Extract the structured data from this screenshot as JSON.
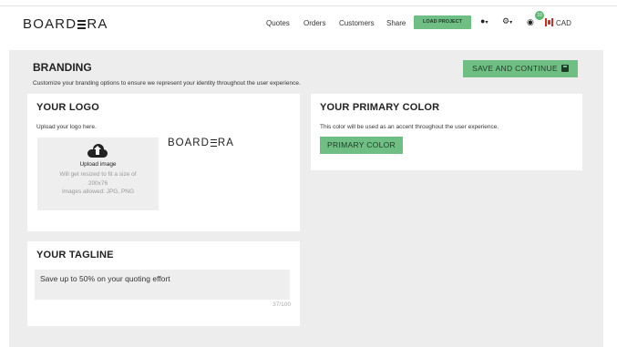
{
  "header": {
    "logo_text_left": "BOARD",
    "logo_text_right": "RA",
    "nav": [
      "Quotes",
      "Orders",
      "Customers",
      "Share"
    ],
    "load_project_label": "LOAD PROJECT",
    "user_icon": "user-icon",
    "settings_icon": "gear-icon",
    "notifications_icon": "chat-icon",
    "notifications_count": "10",
    "currency": "CAD"
  },
  "page": {
    "title": "BRANDING",
    "subtitle": "Customize your branding options to ensure we represent your identity throughout the user experience.",
    "save_label": "SAVE AND CONTINUE"
  },
  "logo_card": {
    "title": "YOUR LOGO",
    "description": "Upload your logo here.",
    "upload_label": "Upload image",
    "upload_help_1": "Will get resized to fit a size of 200x76",
    "upload_help_2": "Images allowed: JPG, PNG",
    "preview_left": "BOARD",
    "preview_right": "RA"
  },
  "color_card": {
    "title": "YOUR PRIMARY COLOR",
    "description": "This color will be used as an accent throughout the user experience.",
    "button_label": "PRIMARY COLOR"
  },
  "tagline_card": {
    "title": "YOUR TAGLINE",
    "value": "Save up to 50% on your quoting effort",
    "counter": "37/100"
  },
  "colors": {
    "accent": "#6fbf84",
    "accent_text": "#1d3b26",
    "background": "#ededed"
  }
}
